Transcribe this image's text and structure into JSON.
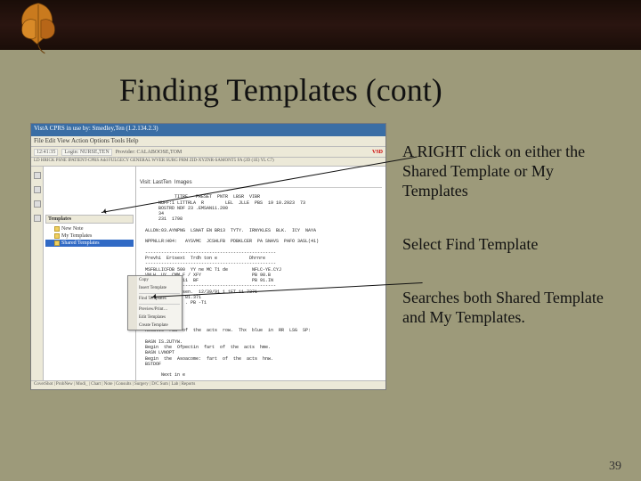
{
  "slide": {
    "title": "Finding Templates (cont)",
    "page_number": "39"
  },
  "notes": {
    "n1": "A RIGHT click on either the Shared Template or My Templates",
    "n2": "Select Find Template",
    "n3": "Searches both Shared Template and My Templates."
  },
  "app": {
    "titlebar": "VistA CPRS in use by: Smedley,Ten  (1.2.134.2.3)",
    "menubar": "File  Edit  View  Action  Options  Tools  Help",
    "toolbar": {
      "time": "12:41:35",
      "user": "Login: NURSE,TEN",
      "provider": "Provider: CALABOOSE,TOM",
      "vsd": "VSD"
    },
    "subbar": "LD HRICK PSNE IPATIENT-CPRS Add  FULGECY  GENERAL WVER  SURG PRM  ZID-XYZNR-SAMONT5  FA (2D (1E) YL C7)",
    "content_header": "Visit: LastTen  Images",
    "tree": {
      "header": "Templates",
      "items": [
        "New Note",
        "My Templates",
        "Shared Templates"
      ]
    },
    "context_menu": {
      "items_a": [
        "Copy",
        "Insert Template"
      ],
      "find": "Find Templates",
      "items_b": [
        "Preview/Print…",
        "Edit Templates",
        "Create Template"
      ]
    },
    "content": "   TITRE   PRESET  PNTR  LBSR  VIBR\n       NUFF:1 LITTRLA  R        LEL  JLLE  PBS  19 10.2923  73\n       BOSTRD NDF 23 .EMSAN11.200\n       34\n       231  1798\n\n  ALLDN:03.AYNPNG  LSNAT EN BR13  TYTY.  IRNYKLES  BLK.  ICY  NAYA\n\n  NPPNLLR:H04:   AYSVMC  JCSHLFB  PDBKLCER  PA SNAVS  PAFO 3ASL(41)\n\n  -------------------------------------------------\n  Prevhi  Ertsext  Trdh ton e            Dhrnre\n  -------------------------------------------------\n  MSFBLLICFDB 500  YY ne MC T1 de         NFLC-YE.CYJ\n  VNLH. UY  CMM F / XFY                   PB 98.B\n  NOSFCS/TElEWP 11  BF                    PB 91.IN\n  -------------------------------------------------\n  Ne  Visor Troosen.  12/39/91 1 1ET 11 7371\n  12.171.3C1.E1  81.371\n  FSN ALNE.  L R . PB -T1\n  ST .(B -15-F)\n  P   14\n  BP  10\n  TB  (M-1T%)\n  Results  rud  of  the  acts  row.  Thx  blue  in  RR  LSG  SP:\n\n  BASN IS.2UTYW.\n  Begin  the  Ofpectin  fart  of  the  acts  hme.\n  BASN LVNOPT\n  Begin  the  Asoacome:  fart  of  the  acts  hnw.\n  BSTDOF\n\n        Next in e\n\n  LNHRNDC OPATE.JACTK(2.   GL RE  AFTS RB _LIBRH______.________________________-",
    "tabs": "CoverShot | ProbNew | Modi_ | Chart | Note | Consults | Surgery | D/C Sum | Lab | Reports"
  }
}
